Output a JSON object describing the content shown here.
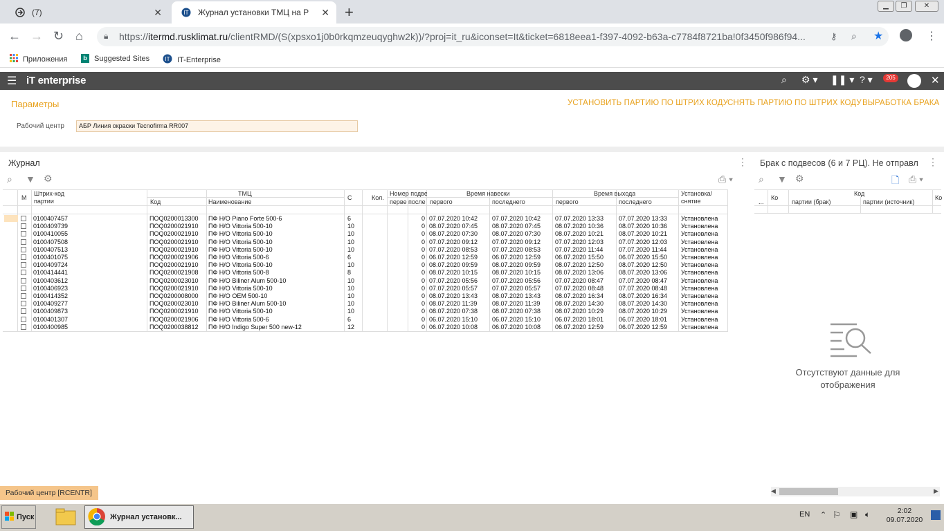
{
  "browser": {
    "tabs": [
      {
        "title": "(7)"
      },
      {
        "title": "Журнал установки ТМЦ на РЦ - RT"
      }
    ],
    "url_prefix": "https://",
    "url_domain": "itermd.rusklimat.ru",
    "url_rest": "/clientRMD/(S(xpsxo1j0b0rkqmzeuqyghw2k))/?proj=it_ru&iconset=It&ticket=6818eea1-f397-4092-b63a-c7784f8721ba!0f3450f986f94...",
    "bookmarks": [
      "Приложения",
      "Suggested Sites",
      "IT-Enterprise"
    ]
  },
  "app": {
    "logo": "enterprise",
    "notif_count": "205"
  },
  "params": {
    "title": "Параметры",
    "links": [
      "УСТАНОВИТЬ ПАРТИЮ ПО ШТРИХ КОДУ",
      "СНЯТЬ ПАРТИЮ ПО ШТРИХ КОДУ",
      "ВЫРАБОТКА БРАКА"
    ],
    "work_center_label": "Рабочий центр",
    "work_center_value": "АБР Линия окраски Tecnofirma RR007"
  },
  "journal": {
    "title": "Журнал",
    "headers": {
      "m": "М",
      "barcode": "Штрих-код",
      "batch": "партии",
      "tmc": "ТМЦ",
      "code": "Код",
      "name": "Наименование",
      "c": "С",
      "qty": "Кол.",
      "hanger": "Номер подве",
      "first_short": "перве",
      "last_short": "после",
      "hang_time": "Время навески",
      "exit_time": "Время выхода",
      "first": "первого",
      "last": "последнего",
      "install1": "Установка/",
      "install2": "снятие"
    },
    "rows": [
      {
        "barcode": "0100407457",
        "code": "ПОQ0200013300",
        "name": "ПФ Н/О Piano Forte 500-6",
        "c": "6",
        "last": "0",
        "h1": "07.07.2020 10:42",
        "h2": "07.07.2020 10:42",
        "e1": "07.07.2020 13:33",
        "e2": "07.07.2020 13:33",
        "st": "Установлена"
      },
      {
        "barcode": "0100409739",
        "code": "ПОQ0200021910",
        "name": "ПФ Н/О Vittoria 500-10",
        "c": "10",
        "last": "0",
        "h1": "08.07.2020 07:45",
        "h2": "08.07.2020 07:45",
        "e1": "08.07.2020 10:36",
        "e2": "08.07.2020 10:36",
        "st": "Установлена"
      },
      {
        "barcode": "0100410055",
        "code": "ПОQ0200021910",
        "name": "ПФ Н/О Vittoria 500-10",
        "c": "10",
        "last": "0",
        "h1": "08.07.2020 07:30",
        "h2": "08.07.2020 07:30",
        "e1": "08.07.2020 10:21",
        "e2": "08.07.2020 10:21",
        "st": "Установлена"
      },
      {
        "barcode": "0100407508",
        "code": "ПОQ0200021910",
        "name": "ПФ Н/О Vittoria 500-10",
        "c": "10",
        "last": "0",
        "h1": "07.07.2020 09:12",
        "h2": "07.07.2020 09:12",
        "e1": "07.07.2020 12:03",
        "e2": "07.07.2020 12:03",
        "st": "Установлена"
      },
      {
        "barcode": "0100407513",
        "code": "ПОQ0200021910",
        "name": "ПФ Н/О Vittoria 500-10",
        "c": "10",
        "last": "0",
        "h1": "07.07.2020 08:53",
        "h2": "07.07.2020 08:53",
        "e1": "07.07.2020 11:44",
        "e2": "07.07.2020 11:44",
        "st": "Установлена"
      },
      {
        "barcode": "0100401075",
        "code": "ПОQ0200021906",
        "name": "ПФ Н/О Vittoria 500-6",
        "c": "6",
        "last": "0",
        "h1": "06.07.2020 12:59",
        "h2": "06.07.2020 12:59",
        "e1": "06.07.2020 15:50",
        "e2": "06.07.2020 15:50",
        "st": "Установлена"
      },
      {
        "barcode": "0100409724",
        "code": "ПОQ0200021910",
        "name": "ПФ Н/О Vittoria 500-10",
        "c": "10",
        "last": "0",
        "h1": "08.07.2020 09:59",
        "h2": "08.07.2020 09:59",
        "e1": "08.07.2020 12:50",
        "e2": "08.07.2020 12:50",
        "st": "Установлена"
      },
      {
        "barcode": "0100414441",
        "code": "ПОQ0200021908",
        "name": "ПФ Н/О Vittoria 500-8",
        "c": "8",
        "last": "0",
        "h1": "08.07.2020 10:15",
        "h2": "08.07.2020 10:15",
        "e1": "08.07.2020 13:06",
        "e2": "08.07.2020 13:06",
        "st": "Установлена"
      },
      {
        "barcode": "0100403612",
        "code": "ПОQ0200023010",
        "name": "ПФ Н/О Biliner Alum 500-10",
        "c": "10",
        "last": "0",
        "h1": "07.07.2020 05:56",
        "h2": "07.07.2020 05:56",
        "e1": "07.07.2020 08:47",
        "e2": "07.07.2020 08:47",
        "st": "Установлена"
      },
      {
        "barcode": "0100406923",
        "code": "ПОQ0200021910",
        "name": "ПФ Н/О Vittoria 500-10",
        "c": "10",
        "last": "0",
        "h1": "07.07.2020 05:57",
        "h2": "07.07.2020 05:57",
        "e1": "07.07.2020 08:48",
        "e2": "07.07.2020 08:48",
        "st": "Установлена"
      },
      {
        "barcode": "0100414352",
        "code": "ПОQ0200008000",
        "name": "ПФ Н/О OEM 500-10",
        "c": "10",
        "last": "0",
        "h1": "08.07.2020 13:43",
        "h2": "08.07.2020 13:43",
        "e1": "08.07.2020 16:34",
        "e2": "08.07.2020 16:34",
        "st": "Установлена"
      },
      {
        "barcode": "0100409277",
        "code": "ПОQ0200023010",
        "name": "ПФ Н/О Biliner Alum 500-10",
        "c": "10",
        "last": "0",
        "h1": "08.07.2020 11:39",
        "h2": "08.07.2020 11:39",
        "e1": "08.07.2020 14:30",
        "e2": "08.07.2020 14:30",
        "st": "Установлена"
      },
      {
        "barcode": "0100409873",
        "code": "ПОQ0200021910",
        "name": "ПФ Н/О Vittoria 500-10",
        "c": "10",
        "last": "0",
        "h1": "08.07.2020 07:38",
        "h2": "08.07.2020 07:38",
        "e1": "08.07.2020 10:29",
        "e2": "08.07.2020 10:29",
        "st": "Установлена"
      },
      {
        "barcode": "0100401307",
        "code": "ПОQ0200021906",
        "name": "ПФ Н/О Vittoria 500-6",
        "c": "6",
        "last": "0",
        "h1": "06.07.2020 15:10",
        "h2": "06.07.2020 15:10",
        "e1": "06.07.2020 18:01",
        "e2": "06.07.2020 18:01",
        "st": "Установлена"
      },
      {
        "barcode": "0100400985",
        "code": "ПОQ0200038812",
        "name": "ПФ Н/О Indigo Super 500 new-12",
        "c": "12",
        "last": "0",
        "h1": "06.07.2020 10:08",
        "h2": "06.07.2020 10:08",
        "e1": "06.07.2020 12:59",
        "e2": "06.07.2020 12:59",
        "st": "Установлена"
      }
    ]
  },
  "defect": {
    "title": "Брак с подвесов (6 и 7 РЦ). Не отправл",
    "headers": {
      "dots": "...",
      "ko": "Ко",
      "code": "Код",
      "batch_defect": "партии (брак)",
      "batch_source": "партии (источник)",
      "ko2": "Ко"
    },
    "empty": "Отсутствуют данные для отображения"
  },
  "status": {
    "label": "Рабочий центр [RCENTR]"
  },
  "taskbar": {
    "start": "Пуск",
    "task": "Журнал установк...",
    "lang": "EN",
    "time": "2:02",
    "date": "09.07.2020"
  }
}
